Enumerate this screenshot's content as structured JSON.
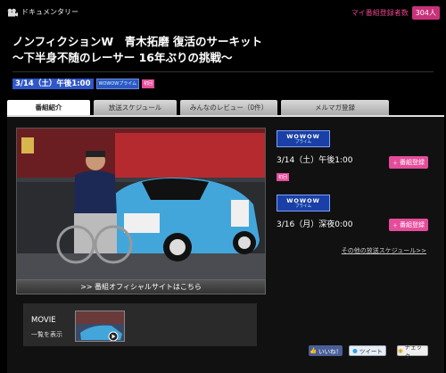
{
  "topbar": {
    "category": "ドキュメンタリー",
    "category_icon": "film-camera-icon",
    "count_label": "マイ番組登録者数",
    "count_value": "304人"
  },
  "program": {
    "title_line1": "ノンフィクションW　青木拓磨 復活のサーキット",
    "title_line2": "〜下半身不随のレーサー 16年ぶりの挑戦〜"
  },
  "airline": {
    "date": "3/14（土）午後1:00",
    "channel": "WOWOWプライム",
    "badge": "初回"
  },
  "tabs": [
    {
      "label": "番組紹介"
    },
    {
      "label": "放送スケジュール"
    },
    {
      "label": "みんなのレビュー（0件）"
    },
    {
      "label": "メルマガ登録"
    }
  ],
  "photo_link": ">> 番組オフィシャルサイトはこちら",
  "movie": {
    "title": "MOVIE",
    "link": "一覧を表示"
  },
  "schedule": [
    {
      "logo_main": "WOWOW",
      "logo_sub": "プライム",
      "time": "3/14（土）午後1:00",
      "register": "番組登録",
      "badge": "初回"
    },
    {
      "logo_main": "WOWOW",
      "logo_sub": "プライム",
      "time": "3/16（月）深夜0:00",
      "register": "番組登録"
    }
  ],
  "other_schedule": "その他の放送スケジュール>>",
  "social": {
    "like": "いいね！",
    "tweet": "ツイート",
    "check": "チェック"
  },
  "colors": {
    "accent_pink": "#e54c9b",
    "wowow_blue": "#1a3fa6",
    "background": "#000000"
  }
}
